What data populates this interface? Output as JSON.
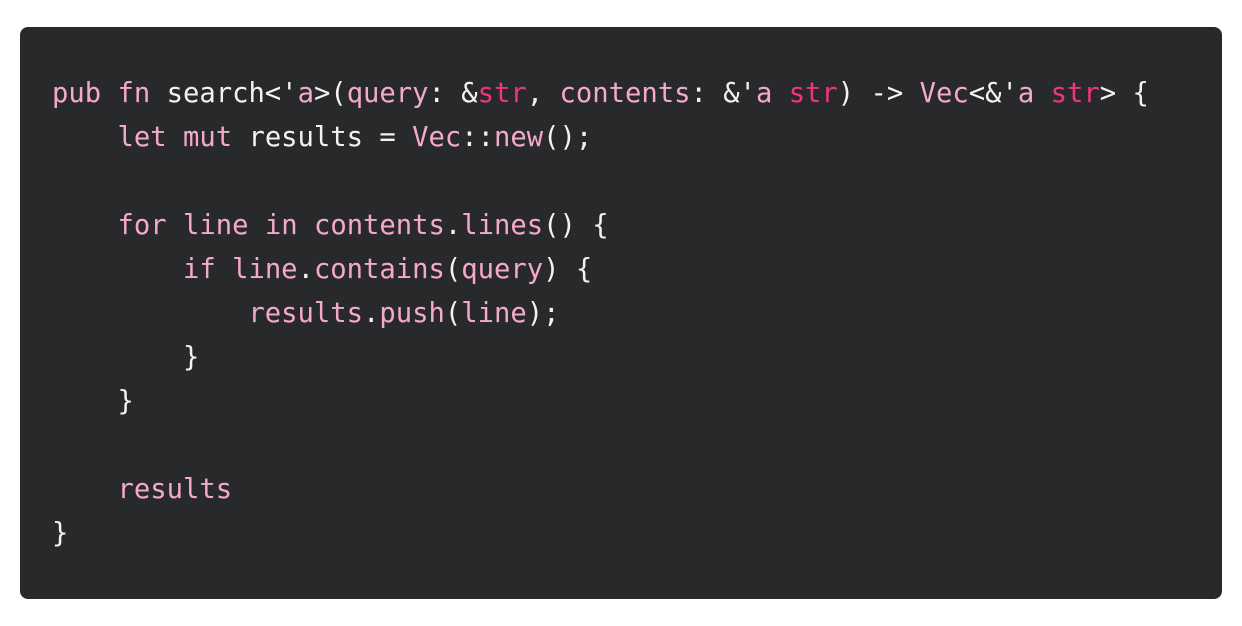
{
  "colors": {
    "background": "#28292b",
    "text": "#f2f2f2",
    "highlight": "#f5a9c8",
    "type": "#f2357a"
  },
  "code": {
    "language": "rust",
    "lines": [
      [
        {
          "t": "pub",
          "c": "pink"
        },
        {
          "t": " ",
          "c": "plain"
        },
        {
          "t": "fn",
          "c": "pink"
        },
        {
          "t": " search<'",
          "c": "plain"
        },
        {
          "t": "a",
          "c": "pink"
        },
        {
          "t": ">(",
          "c": "plain"
        },
        {
          "t": "query",
          "c": "pink"
        },
        {
          "t": ": &",
          "c": "plain"
        },
        {
          "t": "str",
          "c": "magenta"
        },
        {
          "t": ", ",
          "c": "plain"
        },
        {
          "t": "contents",
          "c": "pink"
        },
        {
          "t": ": &'",
          "c": "plain"
        },
        {
          "t": "a",
          "c": "pink"
        },
        {
          "t": " ",
          "c": "plain"
        },
        {
          "t": "str",
          "c": "magenta"
        },
        {
          "t": ") -> ",
          "c": "plain"
        },
        {
          "t": "Vec",
          "c": "pink"
        },
        {
          "t": "<&'",
          "c": "plain"
        },
        {
          "t": "a",
          "c": "pink"
        },
        {
          "t": " ",
          "c": "plain"
        },
        {
          "t": "str",
          "c": "magenta"
        },
        {
          "t": "> {",
          "c": "plain"
        }
      ],
      [
        {
          "t": "    ",
          "c": "plain"
        },
        {
          "t": "let",
          "c": "pink"
        },
        {
          "t": " ",
          "c": "plain"
        },
        {
          "t": "mut",
          "c": "pink"
        },
        {
          "t": " results = ",
          "c": "plain"
        },
        {
          "t": "Vec",
          "c": "pink"
        },
        {
          "t": "::",
          "c": "plain"
        },
        {
          "t": "new",
          "c": "pink"
        },
        {
          "t": "();",
          "c": "plain"
        }
      ],
      [],
      [
        {
          "t": "    ",
          "c": "plain"
        },
        {
          "t": "for",
          "c": "pink"
        },
        {
          "t": " ",
          "c": "plain"
        },
        {
          "t": "line",
          "c": "pink"
        },
        {
          "t": " ",
          "c": "plain"
        },
        {
          "t": "in",
          "c": "pink"
        },
        {
          "t": " ",
          "c": "plain"
        },
        {
          "t": "contents",
          "c": "pink"
        },
        {
          "t": ".",
          "c": "plain"
        },
        {
          "t": "lines",
          "c": "pink"
        },
        {
          "t": "() {",
          "c": "plain"
        }
      ],
      [
        {
          "t": "        ",
          "c": "plain"
        },
        {
          "t": "if",
          "c": "pink"
        },
        {
          "t": " ",
          "c": "plain"
        },
        {
          "t": "line",
          "c": "pink"
        },
        {
          "t": ".",
          "c": "plain"
        },
        {
          "t": "contains",
          "c": "pink"
        },
        {
          "t": "(",
          "c": "plain"
        },
        {
          "t": "query",
          "c": "pink"
        },
        {
          "t": ") {",
          "c": "plain"
        }
      ],
      [
        {
          "t": "            ",
          "c": "plain"
        },
        {
          "t": "results",
          "c": "pink"
        },
        {
          "t": ".",
          "c": "plain"
        },
        {
          "t": "push",
          "c": "pink"
        },
        {
          "t": "(",
          "c": "plain"
        },
        {
          "t": "line",
          "c": "pink"
        },
        {
          "t": ");",
          "c": "plain"
        }
      ],
      [
        {
          "t": "        }",
          "c": "plain"
        }
      ],
      [
        {
          "t": "    }",
          "c": "plain"
        }
      ],
      [],
      [
        {
          "t": "    ",
          "c": "plain"
        },
        {
          "t": "results",
          "c": "pink"
        }
      ],
      [
        {
          "t": "}",
          "c": "plain"
        }
      ]
    ]
  }
}
